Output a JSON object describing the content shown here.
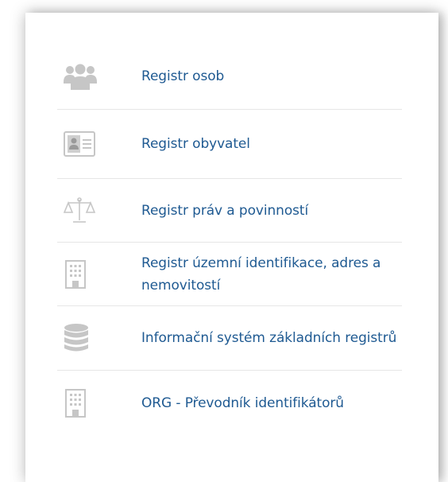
{
  "menu": {
    "items": [
      {
        "label": "Registr osob",
        "icon": "people-group-icon"
      },
      {
        "label": "Registr obyvatel",
        "icon": "id-card-icon"
      },
      {
        "label": "Registr práv a povinností",
        "icon": "scales-icon"
      },
      {
        "label": "Registr územní identifikace, adres a nemovitostí",
        "icon": "building-icon"
      },
      {
        "label": "Informační systém základních registrů",
        "icon": "database-icon"
      },
      {
        "label": "ORG - Převodník identifikátorů",
        "icon": "building-icon"
      }
    ]
  },
  "colors": {
    "link": "#1f5a92",
    "icon": "#c6c6c6",
    "divider": "#e6e6e6"
  }
}
